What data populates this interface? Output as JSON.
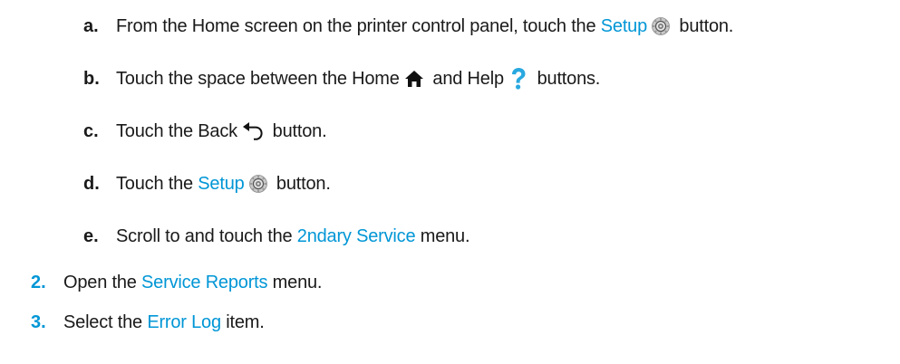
{
  "steps": {
    "a": {
      "marker": "a.",
      "t1": "From the Home screen on the printer control panel, touch the ",
      "link": "Setup",
      "t2": " button."
    },
    "b": {
      "marker": "b.",
      "t1": "Touch the space between the Home ",
      "t2": " and Help ",
      "t3": " buttons."
    },
    "c": {
      "marker": "c.",
      "t1": "Touch the Back ",
      "t2": " button."
    },
    "d": {
      "marker": "d.",
      "t1": "Touch the ",
      "link": "Setup",
      "t2": " button."
    },
    "e": {
      "marker": "e.",
      "t1": "Scroll to and touch the ",
      "link": "2ndary Service",
      "t2": " menu."
    },
    "s2": {
      "marker": "2.",
      "t1": "Open the ",
      "link": "Service Reports",
      "t2": " menu."
    },
    "s3": {
      "marker": "3.",
      "t1": "Select the ",
      "link": "Error Log",
      "t2": " item."
    }
  },
  "icons": {
    "setup": "gear-icon",
    "home": "home-icon",
    "help": "help-icon",
    "back": "back-arrow-icon"
  },
  "colors": {
    "accent": "#0096d6",
    "text": "#1a1a1a"
  }
}
